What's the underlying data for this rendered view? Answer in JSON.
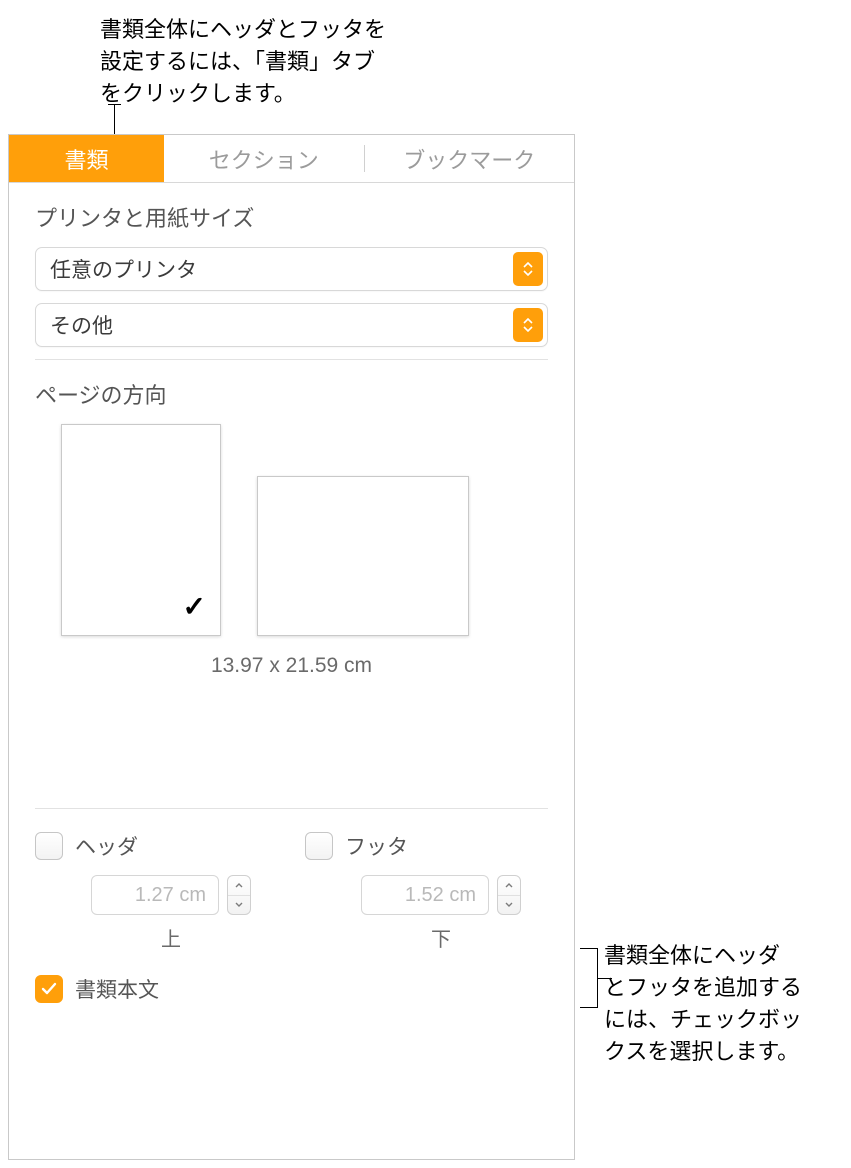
{
  "callouts": {
    "top": "書類全体にヘッダとフッタを\n設定するには、「書類」タブ\nをクリックします。",
    "right": "書類全体にヘッダ\nとフッタを追加する\nには、チェックボッ\nクスを選択します。"
  },
  "tabs": {
    "document": "書類",
    "section": "セクション",
    "bookmark": "ブックマーク"
  },
  "printer_section": {
    "title": "プリンタと用紙サイズ",
    "printer": "任意のプリンタ",
    "paper": "その他"
  },
  "orientation": {
    "title": "ページの方向",
    "dimensions": "13.97 x 21.59 cm"
  },
  "header_footer": {
    "header_label": "ヘッダ",
    "footer_label": "フッタ",
    "header_value": "1.27 cm",
    "footer_value": "1.52 cm",
    "top_caption": "上",
    "bottom_caption": "下"
  },
  "body_text": {
    "label": "書類本文"
  }
}
